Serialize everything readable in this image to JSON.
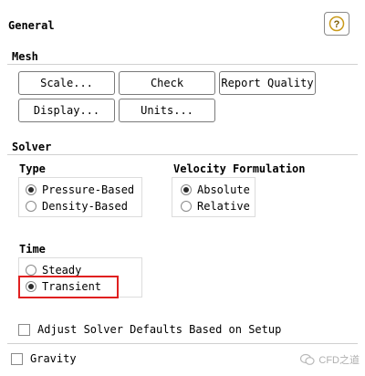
{
  "panel": {
    "title": "General",
    "help_icon": "help-icon"
  },
  "mesh": {
    "heading": "Mesh",
    "buttons": {
      "scale": "Scale...",
      "check": "Check",
      "report_quality": "Report Quality",
      "display": "Display...",
      "units": "Units..."
    }
  },
  "solver": {
    "heading": "Solver",
    "type": {
      "label": "Type",
      "options": [
        "Pressure-Based",
        "Density-Based"
      ],
      "selected": "Pressure-Based"
    },
    "velocity_formulation": {
      "label": "Velocity Formulation",
      "options": [
        "Absolute",
        "Relative"
      ],
      "selected": "Absolute"
    },
    "time": {
      "label": "Time",
      "options": [
        "Steady",
        "Transient"
      ],
      "selected": "Transient"
    },
    "adjust_defaults": {
      "label": "Adjust Solver Defaults Based on Setup",
      "checked": false
    }
  },
  "gravity": {
    "label": "Gravity",
    "checked": false
  },
  "watermark": {
    "text": "CFD之道",
    "icon": "wechat-icon"
  },
  "colors": {
    "highlight": "#e02020",
    "border": "#7a7a7a"
  }
}
